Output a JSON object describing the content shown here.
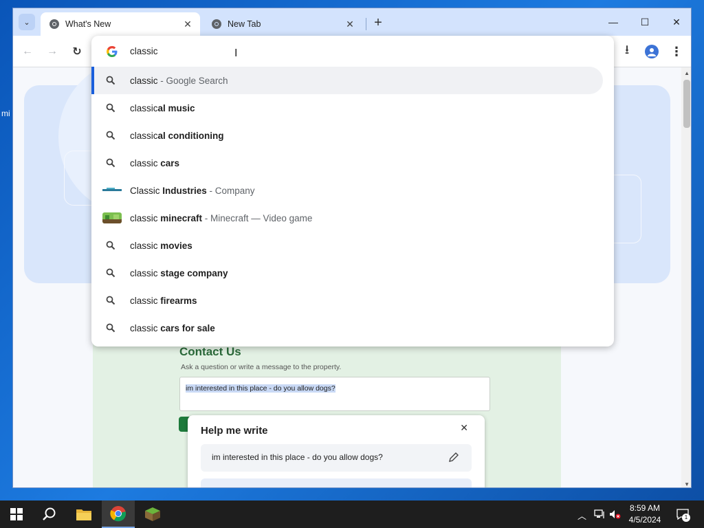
{
  "desktop": {
    "edge_label": "mi"
  },
  "tabs": [
    {
      "title": "What's New",
      "active": true,
      "close": "✕"
    },
    {
      "title": "New Tab",
      "active": false,
      "close": "✕"
    }
  ],
  "tabstrip": {
    "search_tabs": "⌄",
    "new_tab": "+"
  },
  "window_controls": {
    "minimize": "—",
    "maximize": "☐",
    "close": "✕"
  },
  "toolbar": {
    "back": "←",
    "forward": "→",
    "reload": "↻",
    "download": "⭳",
    "menu": "⋮"
  },
  "omnibox": {
    "query": "classic",
    "suggestions": [
      {
        "plain": "classic",
        "bold": "",
        "desc": " - Google Search",
        "icon": "search-icon"
      },
      {
        "plain": "classic",
        "bold": "al music",
        "desc": "",
        "icon": "search-icon"
      },
      {
        "plain": "classic",
        "bold": "al conditioning",
        "desc": "",
        "icon": "search-icon"
      },
      {
        "plain": "classic ",
        "bold": "cars",
        "desc": "",
        "icon": "search-icon"
      },
      {
        "plain": "Classic ",
        "bold": "Industries",
        "desc": " - Company",
        "icon": "company-logo"
      },
      {
        "plain": "classic ",
        "bold": "minecraft",
        "desc": " - Minecraft — Video game",
        "icon": "minecraft-thumbnail"
      },
      {
        "plain": "classic ",
        "bold": "movies",
        "desc": "",
        "icon": "search-icon"
      },
      {
        "plain": "classic ",
        "bold": "stage company",
        "desc": "",
        "icon": "search-icon"
      },
      {
        "plain": "classic ",
        "bold": "firearms",
        "desc": "",
        "icon": "search-icon"
      },
      {
        "plain": "classic ",
        "bold": "cars for sale",
        "desc": "",
        "icon": "search-icon"
      }
    ]
  },
  "contact": {
    "title": "Contact Us",
    "subtitle": "Ask a question or write a message to the property.",
    "message": "im interested in this place - do you allow dogs?"
  },
  "helper": {
    "title": "Help me write",
    "close": "✕",
    "suggestion": "im interested in this place - do you allow dogs?"
  },
  "taskbar": {
    "time": "8:59 AM",
    "date": "4/5/2024",
    "notifications": "1"
  },
  "colors": {
    "accent": "#1a5fdc",
    "tabstrip": "#d3e3fd",
    "contact_green": "#2b6a3a"
  }
}
